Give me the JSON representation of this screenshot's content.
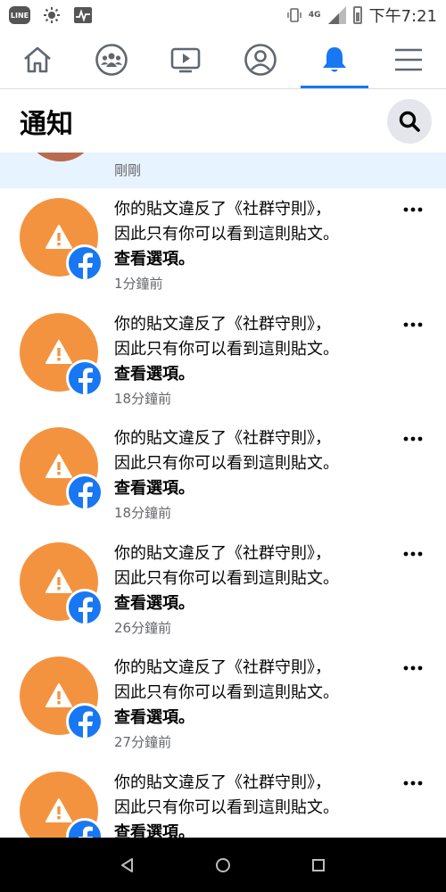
{
  "statusbar": {
    "line_label": "LINE",
    "network": "4G",
    "time": "下午7:21"
  },
  "navbar": {
    "items": [
      {
        "icon": "home-icon"
      },
      {
        "icon": "groups-icon"
      },
      {
        "icon": "watch-icon"
      },
      {
        "icon": "profile-icon"
      },
      {
        "icon": "bell-icon",
        "active": true
      },
      {
        "icon": "menu-icon"
      }
    ],
    "accent": "#1877f2"
  },
  "header": {
    "title": "通知"
  },
  "top_item": {
    "time": "剛剛"
  },
  "notifications": [
    {
      "line1": "你的貼文違反了《社群守則》，",
      "line2": "因此只有你可以看到這則貼文。",
      "action": "查看選項。",
      "time": "1分鐘前"
    },
    {
      "line1": "你的貼文違反了《社群守則》，",
      "line2": "因此只有你可以看到這則貼文。",
      "action": "查看選項。",
      "time": "18分鐘前"
    },
    {
      "line1": "你的貼文違反了《社群守則》，",
      "line2": "因此只有你可以看到這則貼文。",
      "action": "查看選項。",
      "time": "18分鐘前"
    },
    {
      "line1": "你的貼文違反了《社群守則》，",
      "line2": "因此只有你可以看到這則貼文。",
      "action": "查看選項。",
      "time": "26分鐘前"
    },
    {
      "line1": "你的貼文違反了《社群守則》，",
      "line2": "因此只有你可以看到這則貼文。",
      "action": "查看選項。",
      "time": "27分鐘前"
    },
    {
      "line1": "你的貼文違反了《社群守則》，",
      "line2": "因此只有你可以看到這則貼文。",
      "action": "查看選項。",
      "time": ""
    }
  ],
  "colors": {
    "warning_orange": "#f4933f",
    "facebook_blue": "#1877f2",
    "unread_bg": "#e7f3ff"
  }
}
